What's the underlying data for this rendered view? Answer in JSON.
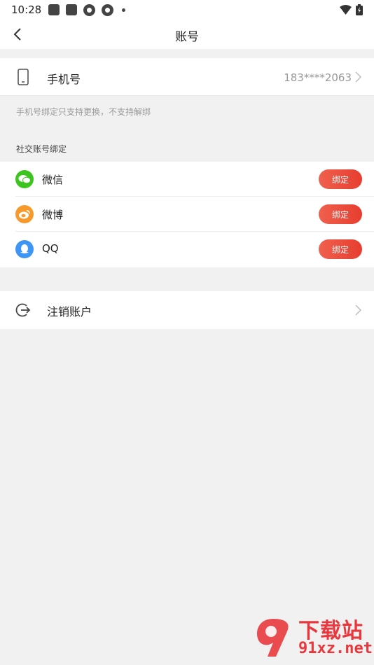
{
  "status_bar": {
    "time": "10:28"
  },
  "nav": {
    "title": "账号"
  },
  "phone_row": {
    "label": "手机号",
    "value": "183****2063"
  },
  "hint": "手机号绑定只支持更换，不支持解绑",
  "social": {
    "section_title": "社交账号绑定",
    "items": [
      {
        "label": "微信",
        "button": "绑定",
        "icon": "wechat-icon",
        "color": "#3cc51f"
      },
      {
        "label": "微博",
        "button": "绑定",
        "icon": "weibo-icon",
        "color": "#f79a2b"
      },
      {
        "label": "QQ",
        "button": "绑定",
        "icon": "qq-icon",
        "color": "#3d95f5"
      }
    ]
  },
  "logout_row": {
    "label": "注销账户"
  },
  "watermark": {
    "line1": "下载站",
    "line2": "91xz.net"
  },
  "colors": {
    "accent": "#e63d2f",
    "background": "#f1f1f1"
  }
}
